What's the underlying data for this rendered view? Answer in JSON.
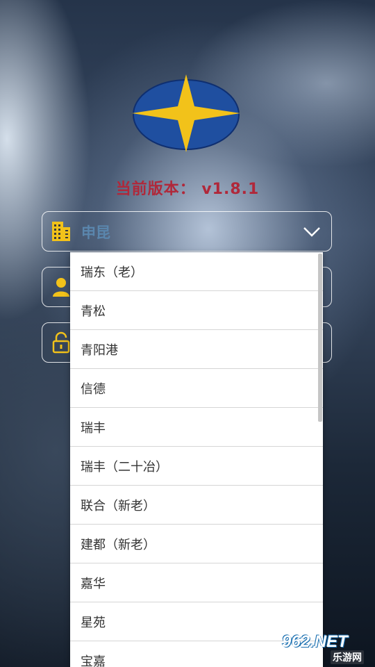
{
  "version_text": "当前版本： v1.8.1",
  "company_select": {
    "value": "申昆",
    "icon": "building-icon"
  },
  "user_field": {
    "icon": "user-icon"
  },
  "password_field": {
    "icon": "lock-icon"
  },
  "dropdown_options": [
    "瑞东（老）",
    "青松",
    "青阳港",
    "信德",
    "瑞丰",
    "瑞丰（二十冶）",
    "联合（新老）",
    "建都（新老）",
    "嘉华",
    "星苑",
    "宝嘉"
  ],
  "watermark": {
    "brand": "962.NET",
    "site": "乐游网"
  },
  "colors": {
    "accent_red": "#b0283a",
    "logo_blue": "#1f4fa0",
    "logo_star": "#f2c21a",
    "icon_yellow": "#f2c21a",
    "selected_text": "#5a86ad"
  }
}
